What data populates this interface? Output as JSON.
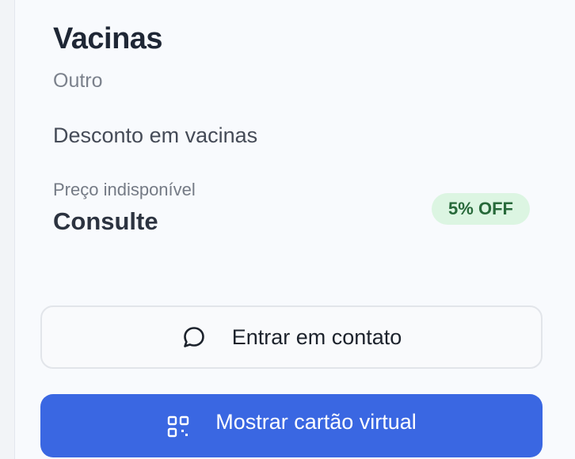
{
  "offer": {
    "title": "Vacinas",
    "category": "Outro",
    "description": "Desconto em vacinas",
    "price_label": "Preço indisponível",
    "price_value": "Consulte",
    "discount_badge": "5% OFF"
  },
  "actions": {
    "contact_label": "Entrar em contato",
    "contact_icon": "chat-bubble-icon",
    "card_label": "Mostrar cartão virtual",
    "card_icon": "qr-code-icon"
  },
  "colors": {
    "primary": "#3a67e2",
    "badge_bg": "#dcf5e2",
    "badge_text": "#27693a"
  }
}
